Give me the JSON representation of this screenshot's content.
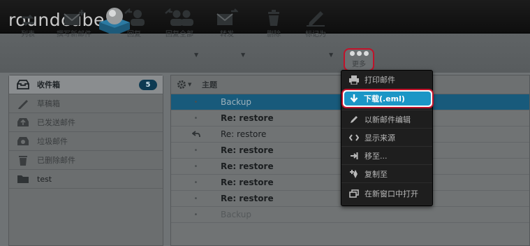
{
  "app": {
    "logo_text": "roundcube"
  },
  "toolbar": {
    "list": "列表",
    "compose": "撰写新邮件",
    "reply": "回复",
    "reply_all": "回复全部",
    "forward": "转发",
    "delete": "删除",
    "mark": "标记为",
    "more": "更多"
  },
  "folders": [
    {
      "label": "收件箱",
      "icon": "inbox-icon",
      "count": "5",
      "active": true
    },
    {
      "label": "草稿箱",
      "icon": "pencil-icon"
    },
    {
      "label": "已发送邮件",
      "icon": "sent-box-icon"
    },
    {
      "label": "垃圾邮件",
      "icon": "junk-box-icon"
    },
    {
      "label": "已删除邮件",
      "icon": "trash-icon"
    },
    {
      "label": "test",
      "icon": "folder-icon"
    }
  ],
  "message_list": {
    "column_subject": "主题",
    "rows": [
      {
        "subject": "Backup",
        "status": "dot",
        "selected": true
      },
      {
        "subject": "Re: restore",
        "status": "dot",
        "bold": true
      },
      {
        "subject": "Re: restore",
        "status": "replied"
      },
      {
        "subject": "Re: restore",
        "status": "dot",
        "bold": true
      },
      {
        "subject": "Re: restore",
        "status": "dot",
        "bold": true
      },
      {
        "subject": "Re: restore",
        "status": "dot",
        "bold": true
      },
      {
        "subject": "Re: restore",
        "status": "dot",
        "bold": true
      },
      {
        "subject": "Backup",
        "status": "dot",
        "faded": true
      }
    ]
  },
  "more_menu": {
    "items": [
      {
        "label": "打印邮件",
        "icon": "print-icon"
      },
      {
        "label": "下载(.eml)",
        "icon": "download-icon",
        "highlighted": true
      },
      {
        "label": "以新邮件编辑",
        "icon": "pencil-icon"
      },
      {
        "label": "显示来源",
        "icon": "code-icon"
      },
      {
        "label": "移至...",
        "icon": "move-icon"
      },
      {
        "label": "复制至",
        "icon": "copy-icon"
      },
      {
        "label": "在新窗口中打开",
        "icon": "new-window-icon"
      }
    ]
  },
  "colors": {
    "accent": "#1b96c6",
    "highlight_border": "#c1122a",
    "badge": "#0d3a52",
    "selected_row": "#185a7b"
  }
}
